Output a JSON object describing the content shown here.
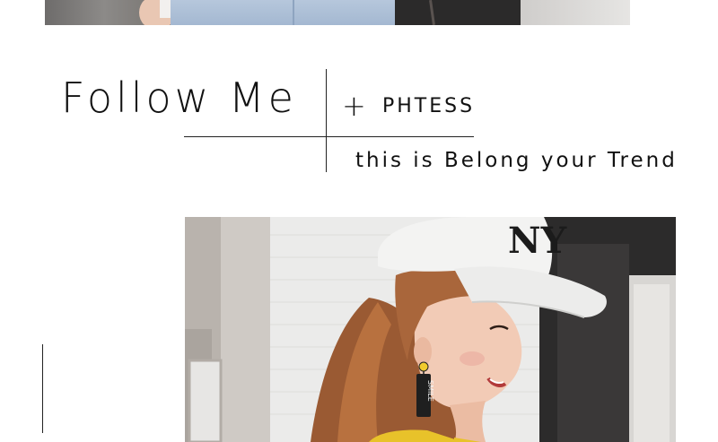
{
  "heading": {
    "title": "Follow Me",
    "plus": "+",
    "brand": "PHTESS",
    "tagline": "this is Belong your Trend"
  },
  "images": {
    "top_photo": "photo-strip",
    "main_photo": "woman-in-white-cap-photo",
    "earring_text": "SMILE"
  },
  "colors": {
    "text": "#111111",
    "rule": "#222222",
    "background": "#ffffff",
    "cap": "#f4f4f4",
    "hair": "#a8663c",
    "skin": "#f1c9b3",
    "shirt": "#e8c22a"
  }
}
